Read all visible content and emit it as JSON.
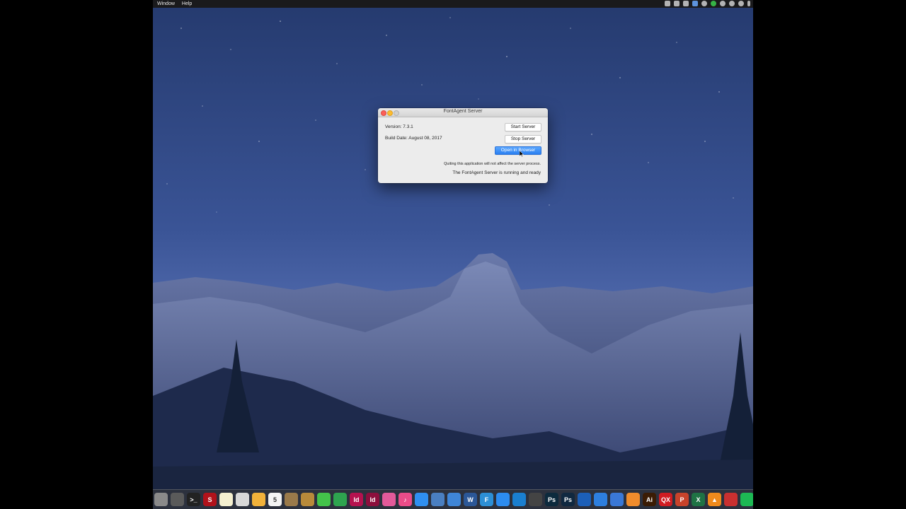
{
  "menubar": {
    "items": [
      "Window",
      "Help"
    ]
  },
  "window": {
    "title": "FontAgent Server",
    "version_label": "Version: 7.3.1",
    "build_date_label": "Build Date: August 08, 2017",
    "start_button": "Start Server",
    "stop_button": "Stop Server",
    "open_browser_button": "Open in Browser",
    "quit_note": "Quiting this application will not affect the server process.",
    "status_message": "The FontAgent Server is running and ready"
  },
  "dock": {
    "icons": [
      {
        "name": "finder-icon",
        "glyph": "",
        "color": "#8a8a8a"
      },
      {
        "name": "mission-control-icon",
        "glyph": "",
        "color": "#5a5a5a"
      },
      {
        "name": "terminal-icon",
        "glyph": ">_",
        "color": "#222222"
      },
      {
        "name": "suitcase-icon",
        "glyph": "S",
        "color": "#b0121b"
      },
      {
        "name": "notes-icon",
        "glyph": "",
        "color": "#f5f0d0"
      },
      {
        "name": "preview-icon",
        "glyph": "",
        "color": "#d8d8d8"
      },
      {
        "name": "photos-icon",
        "glyph": "",
        "color": "#f2b23a"
      },
      {
        "name": "calendar-icon",
        "glyph": "5",
        "color": "#f4f4f4"
      },
      {
        "name": "contacts-icon",
        "glyph": "",
        "color": "#9a7a4a"
      },
      {
        "name": "archive-icon",
        "glyph": "",
        "color": "#b88a3a"
      },
      {
        "name": "messages-icon",
        "glyph": "",
        "color": "#43c24a"
      },
      {
        "name": "evernote-icon",
        "glyph": "",
        "color": "#2ea44f"
      },
      {
        "name": "indesign-icon",
        "glyph": "Id",
        "color": "#b5124f"
      },
      {
        "name": "indesign-cc-icon",
        "glyph": "Id",
        "color": "#8c0f3d"
      },
      {
        "name": "screen-sharing-icon",
        "glyph": "",
        "color": "#e35a9a"
      },
      {
        "name": "itunes-icon",
        "glyph": "♪",
        "color": "#ea4c89"
      },
      {
        "name": "app-store-icon",
        "glyph": "",
        "color": "#2f8ff0"
      },
      {
        "name": "preview-doc-icon",
        "glyph": "",
        "color": "#4a7fc1"
      },
      {
        "name": "chat-icon",
        "glyph": "",
        "color": "#3f86d8"
      },
      {
        "name": "word-icon",
        "glyph": "W",
        "color": "#2b5797"
      },
      {
        "name": "fontagent-icon",
        "glyph": "F",
        "color": "#2c8fd6"
      },
      {
        "name": "safari-icon",
        "glyph": "",
        "color": "#2c8cf0"
      },
      {
        "name": "network-icon",
        "glyph": "",
        "color": "#1a7fd0"
      },
      {
        "name": "stack-icon",
        "glyph": "",
        "color": "#444444"
      },
      {
        "name": "photoshop-icon",
        "glyph": "Ps",
        "color": "#0d2a3d"
      },
      {
        "name": "photoshop-cc-icon",
        "glyph": "Ps",
        "color": "#102840"
      },
      {
        "name": "xcode-icon",
        "glyph": "",
        "color": "#1c5fb8"
      },
      {
        "name": "ichat-icon",
        "glyph": "",
        "color": "#2d7fe0"
      },
      {
        "name": "chrome-icon",
        "glyph": "",
        "color": "#3a78d6"
      },
      {
        "name": "ibooks-icon",
        "glyph": "",
        "color": "#f08c2c"
      },
      {
        "name": "illustrator-icon",
        "glyph": "Ai",
        "color": "#3b1c04"
      },
      {
        "name": "quark-icon",
        "glyph": "QX",
        "color": "#d01c22"
      },
      {
        "name": "powerpoint-icon",
        "glyph": "P",
        "color": "#c8432b"
      },
      {
        "name": "excel-icon",
        "glyph": "X",
        "color": "#1f7244"
      },
      {
        "name": "vlc-icon",
        "glyph": "▲",
        "color": "#f08a1c"
      },
      {
        "name": "filemaker-icon",
        "glyph": "",
        "color": "#c93030"
      },
      {
        "name": "spotify-icon",
        "glyph": "",
        "color": "#1db954"
      }
    ]
  }
}
